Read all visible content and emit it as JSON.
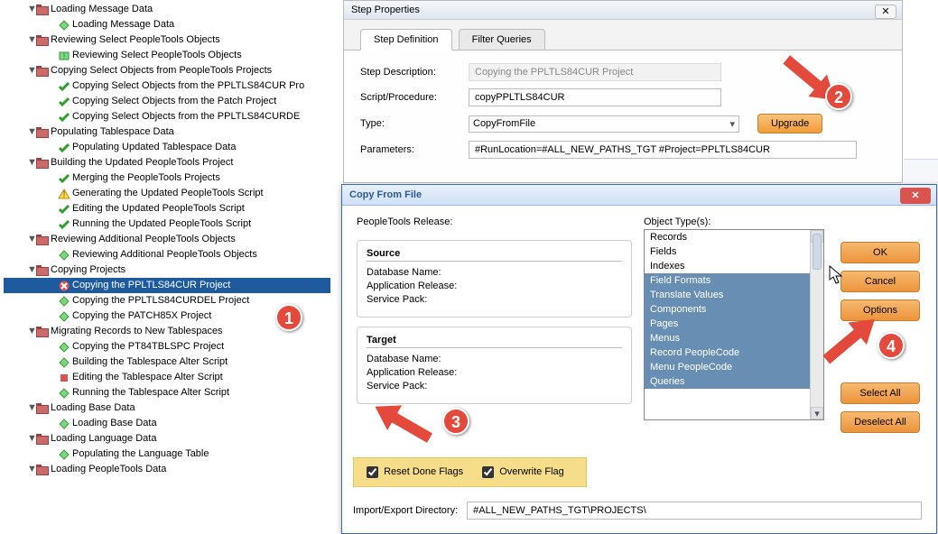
{
  "tree": [
    {
      "indent": 0,
      "twisty": "▼",
      "icon": "folder",
      "label": "Loading Message Data"
    },
    {
      "indent": 1,
      "twisty": "",
      "icon": "diamond",
      "label": "Loading Message Data"
    },
    {
      "indent": 0,
      "twisty": "▼",
      "icon": "folder",
      "label": "Reviewing Select PeopleTools Objects"
    },
    {
      "indent": 1,
      "twisty": "",
      "icon": "warn",
      "label": "Reviewing Select PeopleTools Objects"
    },
    {
      "indent": 0,
      "twisty": "▼",
      "icon": "folder",
      "label": "Copying Select Objects from PeopleTools Projects"
    },
    {
      "indent": 1,
      "twisty": "",
      "icon": "check",
      "label": "Copying Select Objects from the PPLTLS84CUR Pro"
    },
    {
      "indent": 1,
      "twisty": "",
      "icon": "check",
      "label": "Copying Select Objects from the Patch Project"
    },
    {
      "indent": 1,
      "twisty": "",
      "icon": "check",
      "label": "Copying Select Objects from the PPLTLS84CURDE"
    },
    {
      "indent": 0,
      "twisty": "▼",
      "icon": "folder",
      "label": "Populating Tablespace Data"
    },
    {
      "indent": 1,
      "twisty": "",
      "icon": "check",
      "label": "Populating Updated Tablespace Data"
    },
    {
      "indent": 0,
      "twisty": "▼",
      "icon": "folder",
      "label": "Building the Updated PeopleTools Project"
    },
    {
      "indent": 1,
      "twisty": "",
      "icon": "check",
      "label": "Merging the PeopleTools Projects"
    },
    {
      "indent": 1,
      "twisty": "",
      "icon": "warn-y",
      "label": "Generating the Updated PeopleTools Script"
    },
    {
      "indent": 1,
      "twisty": "",
      "icon": "check",
      "label": "Editing the Updated PeopleTools Script"
    },
    {
      "indent": 1,
      "twisty": "",
      "icon": "check",
      "label": "Running the Updated PeopleTools Script"
    },
    {
      "indent": 0,
      "twisty": "▼",
      "icon": "folder",
      "label": "Reviewing Additional PeopleTools Objects"
    },
    {
      "indent": 1,
      "twisty": "",
      "icon": "diamond",
      "label": "Reviewing Additional PeopleTools Objects"
    },
    {
      "indent": 0,
      "twisty": "▼",
      "icon": "folder",
      "label": "Copying Projects"
    },
    {
      "indent": 1,
      "twisty": "",
      "icon": "error",
      "label": "Copying the PPLTLS84CUR Project",
      "sel": true
    },
    {
      "indent": 1,
      "twisty": "",
      "icon": "diamond",
      "label": "Copying the PPLTLS84CURDEL Project"
    },
    {
      "indent": 1,
      "twisty": "",
      "icon": "diamond",
      "label": "Copying the PATCH85X Project"
    },
    {
      "indent": 0,
      "twisty": "▼",
      "icon": "folder",
      "label": "Migrating Records to New Tablespaces"
    },
    {
      "indent": 1,
      "twisty": "",
      "icon": "diamond",
      "label": "Copying the PT84TBLSPC Project"
    },
    {
      "indent": 1,
      "twisty": "",
      "icon": "diamond",
      "label": "Building the Tablespace Alter Script"
    },
    {
      "indent": 1,
      "twisty": "",
      "icon": "stop",
      "label": "Editing the Tablespace Alter Script"
    },
    {
      "indent": 1,
      "twisty": "",
      "icon": "diamond",
      "label": "Running the Tablespace Alter Script"
    },
    {
      "indent": 0,
      "twisty": "▼",
      "icon": "folder",
      "label": "Loading Base Data"
    },
    {
      "indent": 1,
      "twisty": "",
      "icon": "diamond",
      "label": "Loading Base Data"
    },
    {
      "indent": 0,
      "twisty": "▼",
      "icon": "folder",
      "label": "Loading Language Data"
    },
    {
      "indent": 1,
      "twisty": "",
      "icon": "diamond",
      "label": "Populating the Language Table"
    },
    {
      "indent": 0,
      "twisty": "▼",
      "icon": "folder",
      "label": "Loading PeopleTools Data"
    }
  ],
  "stepProps": {
    "title": "Step Properties",
    "tabs": {
      "def": "Step Definition",
      "filter": "Filter Queries"
    },
    "labels": {
      "desc": "Step Description:",
      "proc": "Script/Procedure:",
      "type": "Type:",
      "params": "Parameters:"
    },
    "values": {
      "desc": "Copying the PPLTLS84CUR Project",
      "proc": "copyPPLTLS84CUR",
      "type": "CopyFromFile",
      "params": "#RunLocation=#ALL_NEW_PATHS_TGT #Project=PPLTLS84CUR"
    },
    "upgrade": "Upgrade"
  },
  "copyWin": {
    "title": "Copy From File",
    "release_label": "PeopleTools Release:",
    "source_label": "Source",
    "target_label": "Target",
    "db_label": "Database Name:",
    "app_label": "Application Release:",
    "sp_label": "Service Pack:",
    "objtypes_label": "Object Type(s):",
    "objtypes": [
      "Records",
      "Fields",
      "Indexes",
      "Field Formats",
      "Translate Values",
      "Components",
      "Pages",
      "Menus",
      "Record PeopleCode",
      "Menu PeopleCode",
      "Queries"
    ],
    "sel_from": 3,
    "buttons": {
      "ok": "OK",
      "cancel": "Cancel",
      "options": "Options",
      "selall": "Select All",
      "deselall": "Deselect All"
    },
    "reset_label": "Reset Done Flags",
    "overwrite_label": "Overwrite Flag",
    "impexp_label": "Import/Export Directory:",
    "impexp_val": "#ALL_NEW_PATHS_TGT\\PROJECTS\\"
  },
  "callouts": {
    "c1": "1",
    "c2": "2",
    "c3": "3",
    "c4": "4"
  }
}
